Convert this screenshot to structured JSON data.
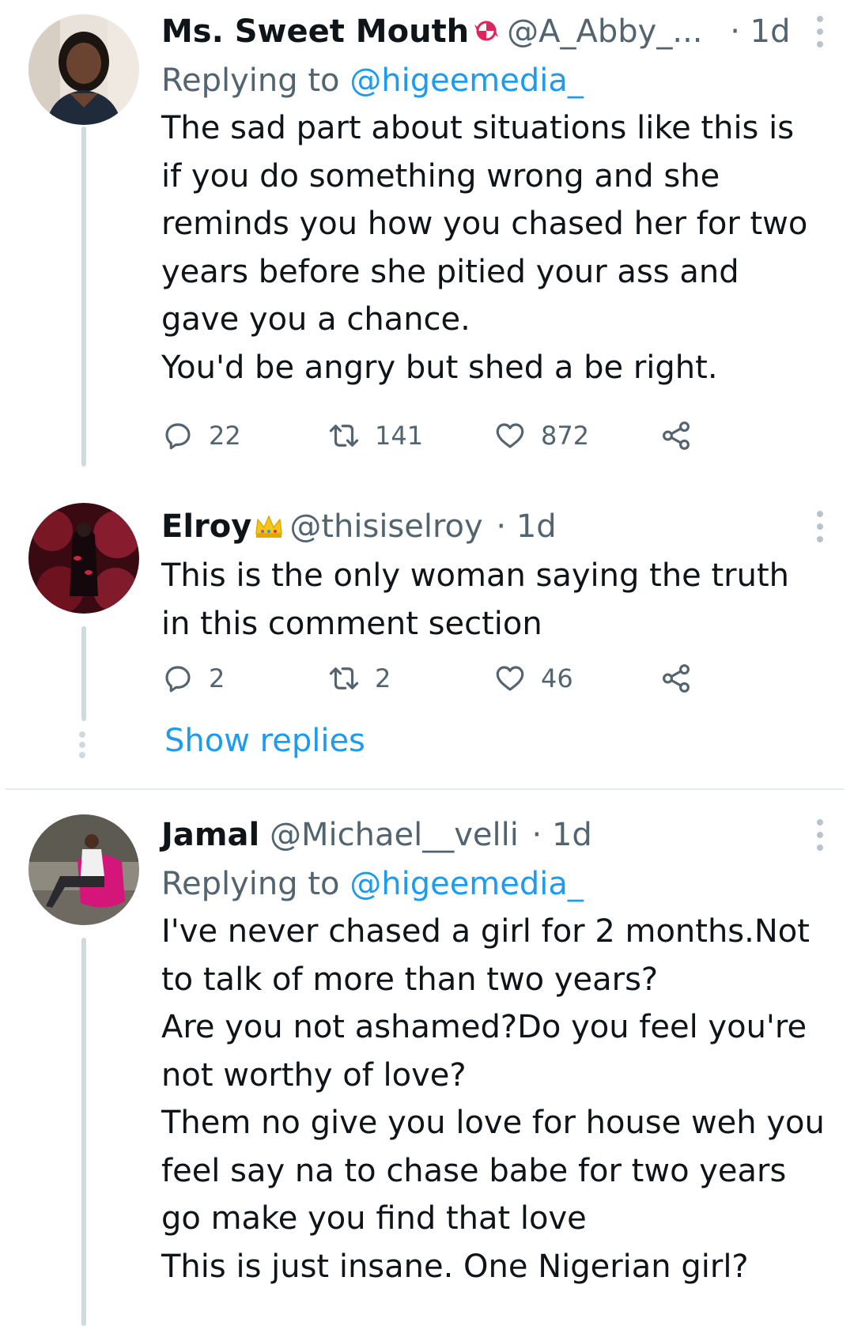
{
  "tweets": [
    {
      "name": "Ms. Sweet Mouth",
      "emoji": "candy-emoji",
      "handle": "@A_Abby_...",
      "time": "· 1d",
      "replying_prefix": "Replying to",
      "replying_to": "@higeemedia_",
      "lines": [
        "The sad part about situations like this is",
        "if you do something wrong and she",
        "reminds you how you chased her for two",
        "years before she pitied your ass and",
        "gave you a chance.",
        "You'd be angry but shed a be right."
      ],
      "replies": "22",
      "retweets": "141",
      "likes": "872"
    },
    {
      "name": "Elroy",
      "emoji": "crown-emoji",
      "handle": "@thisiselroy",
      "time": "· 1d",
      "lines": [
        "This is the only woman saying the truth",
        "in this comment section"
      ],
      "replies": "2",
      "retweets": "2",
      "likes": "46"
    },
    {
      "name": "Jamal",
      "handle": "@Michael__velli",
      "time": "· 1d",
      "replying_prefix": "Replying to",
      "replying_to": "@higeemedia_",
      "lines": [
        "I've never chased a girl for 2 months.Not",
        "to talk of more than two years?",
        "Are you not ashamed?Do you feel you're",
        "not worthy of love?",
        "Them no give you love for house weh you",
        "feel say na to chase babe for two years",
        "go make you find that love",
        "This is just insane. One Nigerian girl?"
      ]
    }
  ],
  "show_replies": "Show replies",
  "icons": {
    "reply": "reply-icon",
    "retweet": "retweet-icon",
    "like": "heart-icon",
    "share": "share-icon"
  },
  "colors": {
    "link": "#1d9bf0",
    "secondary_text": "#536471",
    "thread_line": "#cfd9de"
  }
}
